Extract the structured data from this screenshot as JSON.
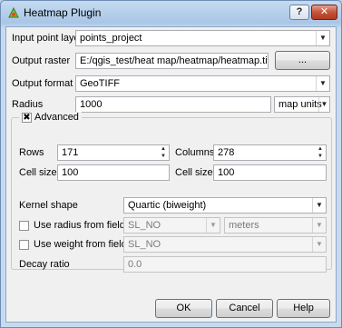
{
  "window": {
    "title": "Heatmap Plugin",
    "help_glyph": "?",
    "close_glyph": "✕",
    "icon": "heatmap-plugin-icon"
  },
  "form": {
    "input_point_layer": {
      "label": "Input point layer",
      "value": "points_project"
    },
    "output_raster": {
      "label": "Output raster",
      "value": "E:/qgis_test/heat map/heatmap/heatmap.tiff",
      "browse_label": "..."
    },
    "output_format": {
      "label": "Output format",
      "value": "GeoTIFF"
    },
    "radius": {
      "label": "Radius",
      "value": "1000",
      "units": "map units"
    }
  },
  "advanced": {
    "title": "Advanced",
    "checked": true,
    "rows": {
      "label": "Rows",
      "value": "171"
    },
    "columns": {
      "label": "Columns",
      "value": "278"
    },
    "cell_size_x": {
      "label": "Cell size X",
      "value": "100"
    },
    "cell_size_y": {
      "label": "Cell size Y",
      "value": "100"
    },
    "kernel_shape": {
      "label": "Kernel shape",
      "value": "Quartic (biweight)"
    },
    "use_radius_from_field": {
      "label": "Use radius from field",
      "checked": false,
      "field": "SL_NO",
      "units": "meters"
    },
    "use_weight_from_field": {
      "label": "Use weight from field",
      "checked": false,
      "field": "SL_NO"
    },
    "decay_ratio": {
      "label": "Decay ratio",
      "value": "0.0"
    }
  },
  "buttons": {
    "ok": "OK",
    "cancel": "Cancel",
    "help": "Help"
  },
  "colors": {
    "titlebar": "#aac6e6",
    "client_bg": "#f0f0f0",
    "close_button": "#c4533a"
  }
}
